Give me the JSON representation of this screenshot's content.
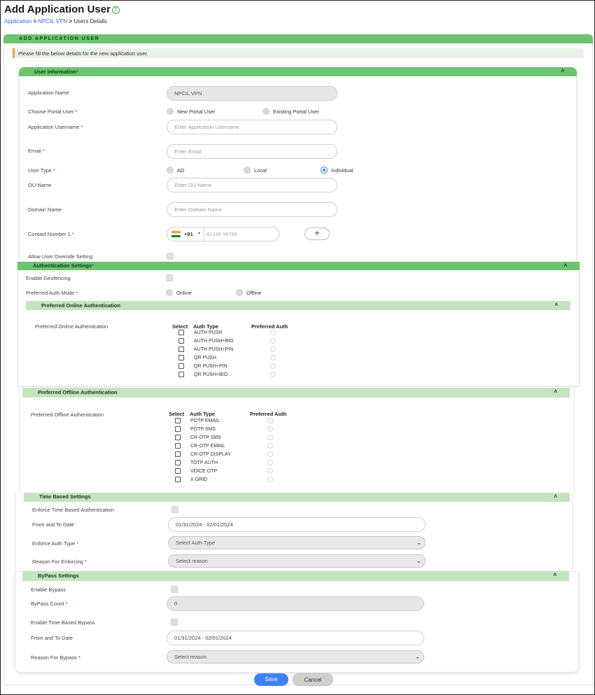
{
  "page": {
    "title": "Add Application User",
    "breadcrumb": {
      "l1": "Application",
      "sep": ">",
      "l2": "NPCIL VPN",
      "l3": "Users Details"
    }
  },
  "colors": {
    "accent_green": "#6bc46f",
    "light_green": "#c4e4c0",
    "primary_blue": "#3b82f6",
    "required_red": "#e02525"
  },
  "icons": {
    "info": "info-icon",
    "collapse": "chevron-up-icon",
    "dropdown": "chevron-down-icon",
    "add": "plus-icon",
    "country_flag": "india-flag-icon"
  },
  "main": {
    "header": "ADD APPLICATION USER",
    "note": "Please fill the below details for the new application user."
  },
  "user_info": {
    "header": "User Information",
    "req": "*",
    "app_name_label": "Application Name",
    "app_name_value": "NPCIL VPN",
    "portal_label": "Choose Portal User",
    "portal_options": [
      "New Portal User",
      "Existing Portal User"
    ],
    "app_username_label": "Application Username",
    "app_username_placeholder": "Enter Application Username",
    "email_label": "Email",
    "email_placeholder": "Enter Email",
    "user_type_label": "User Type",
    "user_type_options": [
      "AD",
      "Local",
      "Individual"
    ],
    "user_type_selected": "Individual",
    "ou_label": "OU Name",
    "ou_placeholder": "Enter OU Name",
    "domain_label": "Domain Name",
    "domain_placeholder": "Enter Domain Name",
    "contact_label": "Contact Number 1",
    "country_code": "+91",
    "phone_placeholder": "81234 56789",
    "add_button": "+",
    "override_label": "Allow User Override Setting"
  },
  "auth": {
    "header": "Authentication Settings",
    "req": "*",
    "geofencing_label": "Enable Geofencing",
    "pref_mode_label": "Preferred Auth Mode",
    "mode_options": [
      "Online",
      "Offline"
    ],
    "online": {
      "header": "Preferred Online Authentication",
      "label": "Preferred Online Authentication",
      "columns": [
        "Select",
        "Auth Type",
        "Preferred Auth"
      ],
      "rows": [
        "AUTH PUSH",
        "AUTH PUSH+BIO",
        "AUTH PUSH+PIN",
        "QR PUSH",
        "QR PUSH+PIN",
        "QR PUSH+BIO"
      ]
    },
    "offline": {
      "header": "Preferred Offline Authentication",
      "label": "Preferred Offline Authentication",
      "columns": [
        "Select",
        "Auth Type",
        "Preferred Auth"
      ],
      "rows": [
        "POTP EMAIL",
        "POTP SMS",
        "CR-OTP SMS",
        "CR-OTP EMAIL",
        "CR-OTP DISPLAY",
        "TOTP AUTH",
        "VOICE OTP",
        "X GRID"
      ]
    }
  },
  "time_based": {
    "header": "Time Based Settings",
    "enforce_label": "Enforce Time Based Authentication",
    "date_label": "From and To Date",
    "date_value": "01/31/2024 - 02/01/2024",
    "auth_type_label": "Enforce Auth Type",
    "auth_type_value": "Select Auth Type",
    "reason_label": "Reason For Enforcing",
    "reason_value": "Select reason"
  },
  "bypass": {
    "header": "ByPass Settings",
    "enable_label": "Enable Bypass",
    "count_label": "ByPass Count",
    "count_value": "0",
    "time_bypass_label": "Enable Time Based Bypass",
    "date_label": "From and To Date",
    "date_value": "01/31/2024 - 02/01/2024",
    "reason_label": "Reason For Bypass",
    "reason_value": "Select reason"
  },
  "actions": {
    "save": "Save",
    "cancel": "Cancel"
  }
}
